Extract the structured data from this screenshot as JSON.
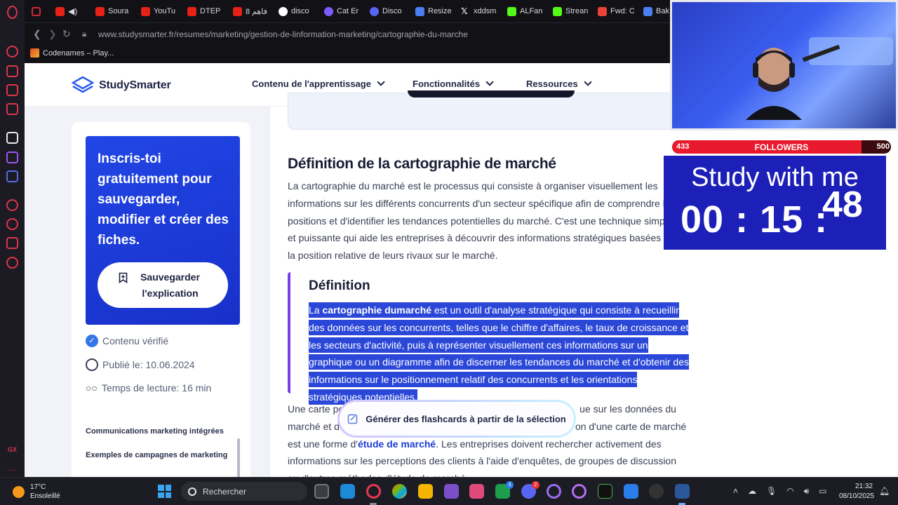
{
  "tabs": [
    {
      "title": "",
      "icon": "media-icon",
      "color": "#cf2a3c"
    },
    {
      "title": "",
      "icon": "youtube-icon",
      "color": "#e62117"
    },
    {
      "title": "Soura",
      "icon": "youtube-icon",
      "color": "#e62117"
    },
    {
      "title": "YouTu",
      "icon": "youtube-icon",
      "color": "#e62117"
    },
    {
      "title": "DTEP",
      "icon": "youtube-icon",
      "color": "#e62117"
    },
    {
      "title": "فاهم 8",
      "icon": "youtube-icon",
      "color": "#e62117"
    },
    {
      "title": "disco",
      "icon": "google-icon",
      "color": "#ffffff"
    },
    {
      "title": "Cat Er",
      "icon": "cat-icon",
      "color": "#7b5cff"
    },
    {
      "title": "Disco",
      "icon": "discord-icon",
      "color": "#5865f2"
    },
    {
      "title": "Resize",
      "icon": "heart-icon",
      "color": "#4b7ef0"
    },
    {
      "title": "xddsm",
      "icon": "x-icon",
      "color": "#ffffff"
    },
    {
      "title": "ALFan",
      "icon": "kick-icon",
      "color": "#53fc18"
    },
    {
      "title": "Strean",
      "icon": "kick-icon",
      "color": "#53fc18"
    },
    {
      "title": "Fwd: C",
      "icon": "gmail-icon",
      "color": "#ea4335"
    },
    {
      "title": "Bak",
      "icon": "b-icon",
      "color": "#4b7ef0"
    }
  ],
  "address": {
    "url": "www.studysmarter.fr/resumes/marketing/gestion-de-linformation-marketing/cartographie-du-marche"
  },
  "bookmarks": [
    {
      "label": "Codenames – Play..."
    }
  ],
  "site": {
    "logo": "StudySmarter",
    "nav": [
      {
        "label": "Contenu de l'apprentissage"
      },
      {
        "label": "Fonctionnalités"
      },
      {
        "label": "Ressources"
      }
    ]
  },
  "sidebar": {
    "promo_text": "Inscris-toi gratuitement pour sauvegarder, modifier et créer des fiches.",
    "save_button": "Sauvegarder l'explication",
    "verified": "Contenu vérifié",
    "published": "Publié le: 10.06.2024",
    "reading_time": "Temps de lecture: 16 min",
    "toc": [
      "Communications marketing intégrées",
      "Exemples de campagnes de marketing"
    ]
  },
  "article": {
    "heading": "Définition de la cartographie de marché",
    "paragraph_1": "La cartographie du marché est le processus qui consiste à organiser visuellement les informations sur les différents concurrents d'un secteur spécifique afin de comprendre les positions et d'identifier les tendances potentielles du marché. C'est une technique simple et puissante qui aide les entreprises à découvrir des informations stratégiques basées sur la position relative de leurs rivaux sur le marché.",
    "definition_title": "Définition",
    "definition_prefix": "La ",
    "definition_term": "cartographie dumarché",
    "definition_rest": " est un outil d'analyse stratégique qui consiste à recueillir des données sur les concurrents, telles que le chiffre d'affaires, le taux de croissance et les secteurs d'activité, puis à représenter visuellement ces informations sur un graphique ou un diagramme afin de discerner les tendances du marché et d'obtenir des informations sur le positionnement relatif des concurrents et les orientations stratégiques potentielles.",
    "paragraph_2_a": "Une carte pe",
    "paragraph_2_b": "ue sur les données du marché et d",
    "paragraph_2_c": "on d'une carte de marché est une forme d'",
    "paragraph_2_link": "étude de marché",
    "paragraph_2_d": ". Les entreprises doivent rechercher activement des informations sur les perceptions des clients à l'aide d'enquêtes, de groupes de discussion ou d'autres méthodes d'étude de marché.",
    "flashcard_button": "Générer des flashcards à partir de la sélection"
  },
  "stream": {
    "followers_current": "433",
    "followers_label": "FOLLOWERS",
    "followers_goal": "500",
    "followers_progress": 0.866,
    "timer_title": "Study with me",
    "timer_hm": "00 : 15 :",
    "timer_sec": "48"
  },
  "taskbar": {
    "temperature": "17°C",
    "weather": "Ensoleillé",
    "search_placeholder": "Rechercher",
    "time": "21:32",
    "date": "08/10/2025",
    "badges": [
      "3",
      "2"
    ]
  },
  "opera": {
    "gx": "GX",
    "more": "..."
  },
  "colors": {
    "accent": "#1c36d8",
    "highlight": "#2b47d8",
    "definition_border": "#7b3cf0",
    "opera_red": "#d9364a"
  }
}
